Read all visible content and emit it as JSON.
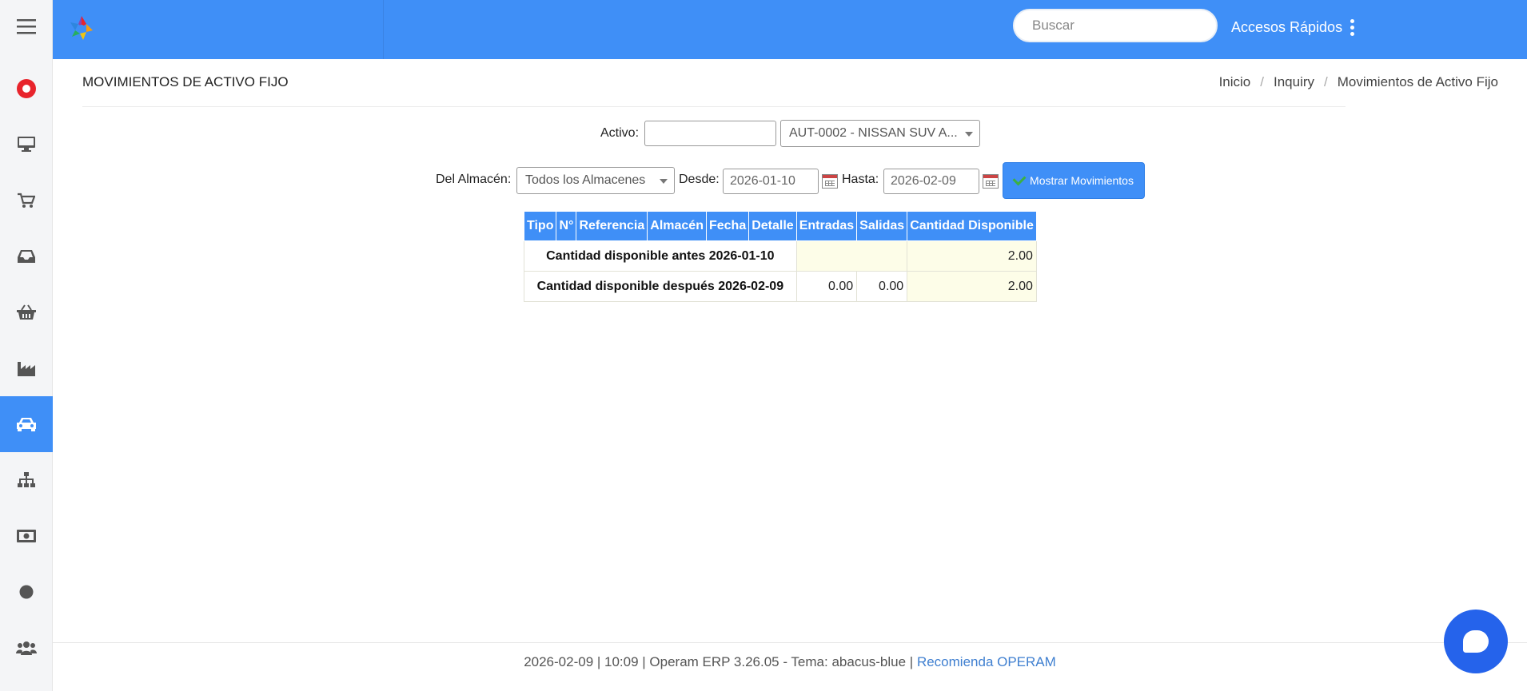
{
  "topbar": {
    "search_placeholder": "Buscar",
    "quick_access": "Accesos Rápidos"
  },
  "sidebar": {
    "items": [
      {
        "icon": "menu-icon"
      },
      {
        "icon": "brand-icon"
      },
      {
        "icon": "desktop-icon"
      },
      {
        "icon": "cart-icon"
      },
      {
        "icon": "inbox-icon"
      },
      {
        "icon": "basket-icon"
      },
      {
        "icon": "industry-icon"
      },
      {
        "icon": "car-icon",
        "active": true
      },
      {
        "icon": "sitemap-icon"
      },
      {
        "icon": "money-icon"
      },
      {
        "icon": "circle-icon"
      },
      {
        "icon": "users-icon"
      }
    ]
  },
  "page": {
    "title": "MOVIMIENTOS DE ACTIVO FIJO",
    "breadcrumb": [
      "Inicio",
      "Inquiry",
      "Movimientos de Activo Fijo"
    ]
  },
  "form": {
    "activo_label": "Activo:",
    "activo_value": "",
    "activo_select": "AUT-0002 - NISSAN SUV A...",
    "almacen_label": "Del Almacén:",
    "almacen_select": "Todos los Almacenes",
    "desde_label": "Desde:",
    "desde_value": "2026-01-10",
    "hasta_label": "Hasta:",
    "hasta_value": "2026-02-09",
    "button_label": "Mostrar Movimientos"
  },
  "table": {
    "headers": [
      "Tipo",
      "N°",
      "Referencia",
      "Almacén",
      "Fecha",
      "Detalle",
      "Entradas",
      "Salidas",
      "Cantidad Disponible"
    ],
    "before_label": "Cantidad disponible antes 2026-01-10",
    "before_qty": "2.00",
    "after_label": "Cantidad disponible después 2026-02-09",
    "after_in": "0.00",
    "after_out": "0.00",
    "after_qty": "2.00"
  },
  "footer": {
    "text": "2026-02-09 | 10:09 | Operam ERP 3.26.05 - Tema: abacus-blue |",
    "link": "Recomienda OPERAM"
  },
  "colors": {
    "primary": "#3f8ff7",
    "chat": "#2563eb",
    "row_highlight": "#fdfde8"
  }
}
